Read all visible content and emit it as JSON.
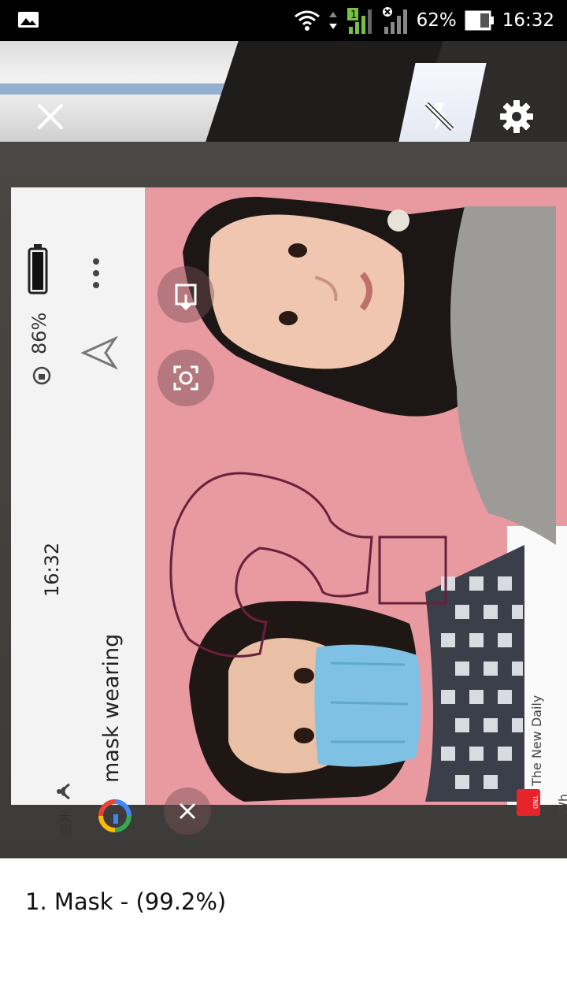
{
  "status_bar": {
    "battery": "62%",
    "time": "16:32",
    "sim_badge": "1"
  },
  "camera_controls": {
    "close_icon": "close-icon",
    "flash_icon": "flash-off-icon",
    "settings_icon": "gear-icon"
  },
  "photographed_screen": {
    "time": "16:32",
    "battery": "86%",
    "search_query": "mask wearing",
    "network_label": "圈外",
    "source_name": "The New Daily",
    "source_badge": "TND",
    "cut_text": "Wh"
  },
  "colors": {
    "pink_background": "#e89aa0",
    "mask_blue": "#7fc1e4"
  },
  "result": {
    "line": "1. Mask - (99.2%)"
  }
}
